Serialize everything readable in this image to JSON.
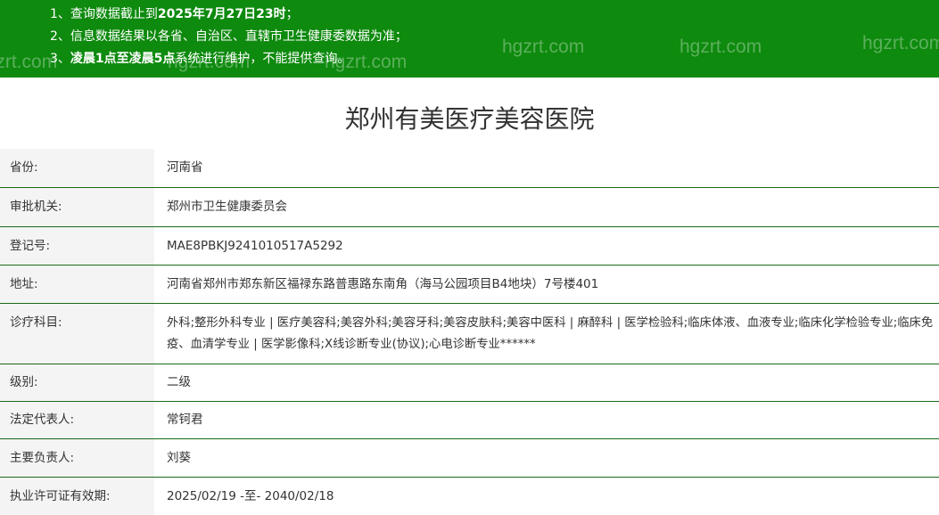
{
  "notice": {
    "items": [
      {
        "prefix": "1、",
        "text": "查询数据截止到",
        "bold": "2025年7月27日23时",
        "suffix": "；"
      },
      {
        "prefix": "2、",
        "text": "信息数据结果以各省、自治区、直辖市卫生健康委数据为准；",
        "bold": "",
        "suffix": ""
      },
      {
        "prefix": "3、",
        "text": "",
        "bold": "凌晨1点至凌晨5点",
        "suffix": "系统进行维护，不能提供查询。"
      }
    ],
    "watermark": "hgzrt.com",
    "colors": {
      "background": "#0e8a0e",
      "text": "#ffffff"
    }
  },
  "hospital": {
    "name": "郑州有美医疗美容医院"
  },
  "details": [
    {
      "label": "省份:",
      "value": "河南省"
    },
    {
      "label": "审批机关:",
      "value": "郑州市卫生健康委员会"
    },
    {
      "label": "登记号:",
      "value": "MAE8PBKJ9241010517A5292"
    },
    {
      "label": "地址:",
      "value": "河南省郑州市郑东新区福禄东路普惠路东南角（海马公园项目B4地块）7号楼401"
    },
    {
      "label": "诊疗科目:",
      "value": "外科;整形外科专业 | 医疗美容科;美容外科;美容牙科;美容皮肤科;美容中医科 | 麻醉科 | 医学检验科;临床体液、血液专业;临床化学检验专业;临床免疫、血清学专业 | 医学影像科;X线诊断专业(协议);心电诊断专业******"
    },
    {
      "label": "级别:",
      "value": "二级"
    },
    {
      "label": "法定代表人:",
      "value": "常钶君"
    },
    {
      "label": "主要负责人:",
      "value": "刘葵"
    },
    {
      "label": "执业许可证有效期:",
      "value": "2025/02/19 -至- 2040/02/18"
    }
  ],
  "colors": {
    "row_divider": "#1a6a1a",
    "label_bg": "#f4f4f4"
  }
}
